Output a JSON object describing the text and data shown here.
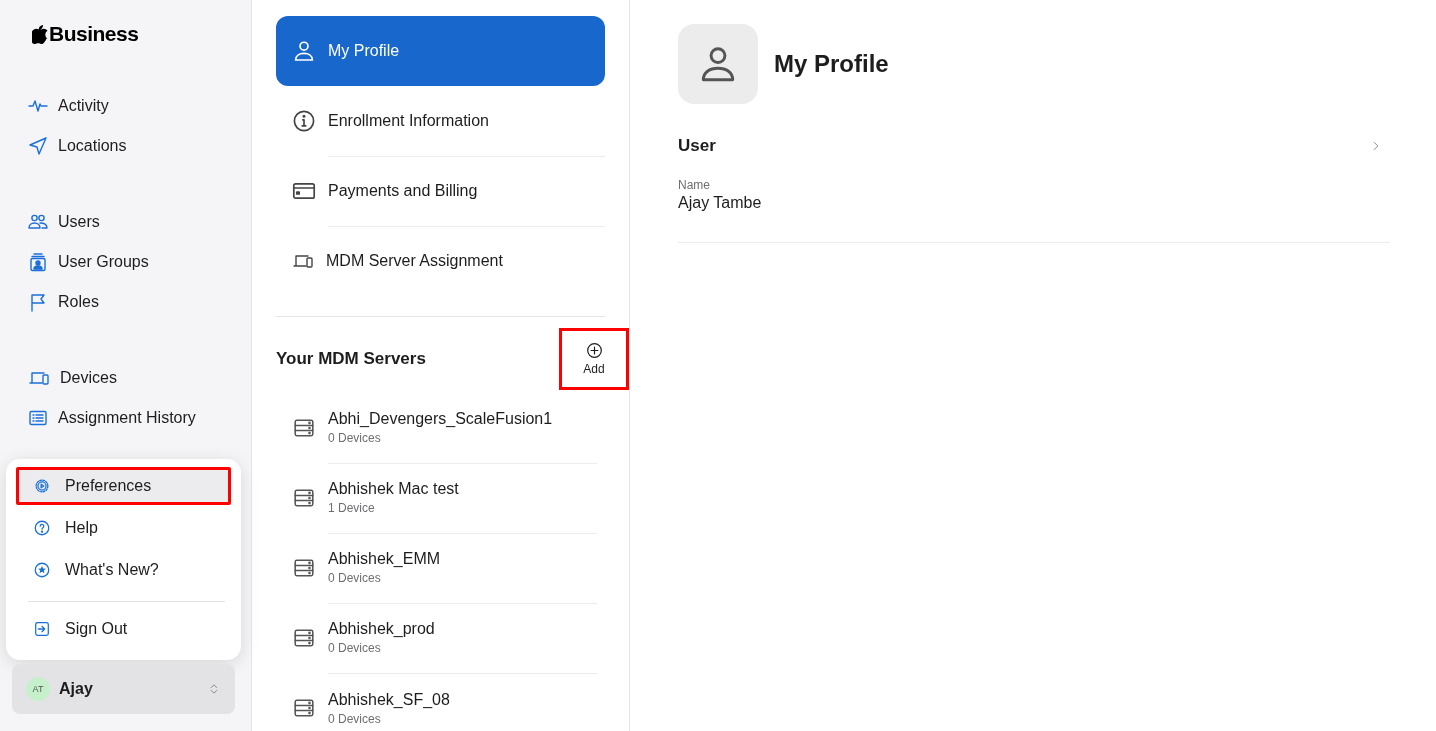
{
  "logo": {
    "text": "Business"
  },
  "sidebar": {
    "sections": [
      {
        "items": [
          {
            "label": "Activity",
            "kind": "activity"
          },
          {
            "label": "Locations",
            "kind": "location"
          }
        ]
      },
      {
        "items": [
          {
            "label": "Users",
            "kind": "users"
          },
          {
            "label": "User Groups",
            "kind": "group"
          },
          {
            "label": "Roles",
            "kind": "flag"
          }
        ]
      },
      {
        "items": [
          {
            "label": "Devices",
            "kind": "devices"
          },
          {
            "label": "Assignment History",
            "kind": "history"
          }
        ]
      }
    ]
  },
  "account_menu": {
    "groups": [
      [
        {
          "label": "Preferences",
          "kind": "gear",
          "selected": true,
          "highlighted": true
        },
        {
          "label": "Help",
          "kind": "help",
          "selected": false,
          "highlighted": false
        },
        {
          "label": "What's New?",
          "kind": "star",
          "selected": false,
          "highlighted": false
        }
      ],
      [
        {
          "label": "Sign Out",
          "kind": "signout",
          "selected": false,
          "highlighted": false
        }
      ]
    ]
  },
  "account": {
    "initials": "AT",
    "name": "Ajay"
  },
  "settings_nav": {
    "items": [
      {
        "label": "My Profile",
        "kind": "profile",
        "selected": true
      },
      {
        "label": "Enrollment Information",
        "kind": "info",
        "selected": false
      },
      {
        "label": "Payments and Billing",
        "kind": "card",
        "selected": false
      },
      {
        "label": "MDM Server Assignment",
        "kind": "devices",
        "selected": false
      }
    ]
  },
  "mdm_servers": {
    "title": "Your MDM Servers",
    "add_button": {
      "label": "Add",
      "highlighted": true
    },
    "servers": [
      {
        "name": "Abhi_Devengers_ScaleFusion1",
        "devices": "0 Devices"
      },
      {
        "name": "Abhishek Mac test",
        "devices": "1 Device"
      },
      {
        "name": "Abhishek_EMM",
        "devices": "0 Devices"
      },
      {
        "name": "Abhishek_prod",
        "devices": "0 Devices"
      },
      {
        "name": "Abhishek_SF_08",
        "devices": "0 Devices"
      }
    ]
  },
  "profile": {
    "title": "My Profile",
    "section": "User",
    "fields": [
      {
        "label": "Name",
        "value": "Ajay Tambe"
      }
    ]
  }
}
